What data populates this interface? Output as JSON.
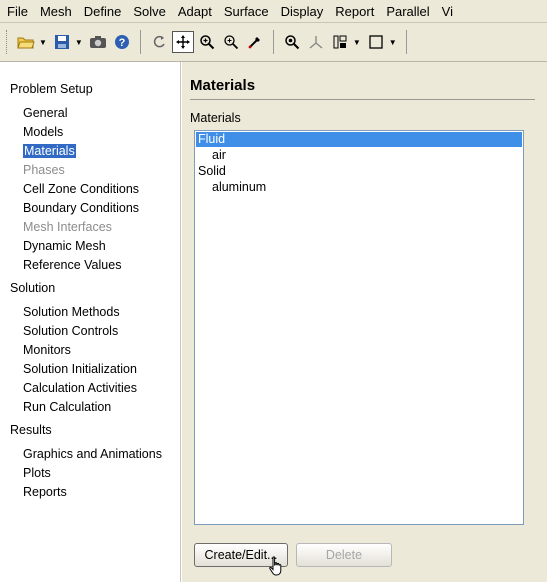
{
  "menubar": {
    "items": [
      "File",
      "Mesh",
      "Define",
      "Solve",
      "Adapt",
      "Surface",
      "Display",
      "Report",
      "Parallel",
      "Vi"
    ]
  },
  "toolbar": {
    "icons": [
      "open-folder-icon",
      "save-icon",
      "camera-icon",
      "help-icon",
      "rotate-icon",
      "pan-icon",
      "zoom-in-icon",
      "zoom-box-icon",
      "probe-icon",
      "fit-icon",
      "axes-icon",
      "layout-icon",
      "window-icon"
    ]
  },
  "nav": {
    "sections": [
      {
        "label": "Problem Setup",
        "items": [
          "General",
          "Models",
          "Materials",
          "Phases",
          "Cell Zone Conditions",
          "Boundary Conditions",
          "Mesh Interfaces",
          "Dynamic Mesh",
          "Reference Values"
        ]
      },
      {
        "label": "Solution",
        "items": [
          "Solution Methods",
          "Solution Controls",
          "Monitors",
          "Solution Initialization",
          "Calculation Activities",
          "Run Calculation"
        ]
      },
      {
        "label": "Results",
        "items": [
          "Graphics and Animations",
          "Plots",
          "Reports"
        ]
      }
    ],
    "selected": "Materials",
    "disabled": [
      "Phases",
      "Mesh Interfaces"
    ]
  },
  "panel": {
    "title": "Materials",
    "list_label": "Materials",
    "list": [
      {
        "label": "Fluid",
        "indent": 0,
        "selected": true
      },
      {
        "label": "air",
        "indent": 1,
        "selected": false
      },
      {
        "label": "Solid",
        "indent": 0,
        "selected": false
      },
      {
        "label": "aluminum",
        "indent": 1,
        "selected": false
      }
    ],
    "buttons": {
      "create_edit": "Create/Edit...",
      "delete": "Delete"
    }
  },
  "colors": {
    "selection": "#316ac5",
    "list_selection": "#3f8ee8",
    "chrome": "#ece9d8"
  }
}
